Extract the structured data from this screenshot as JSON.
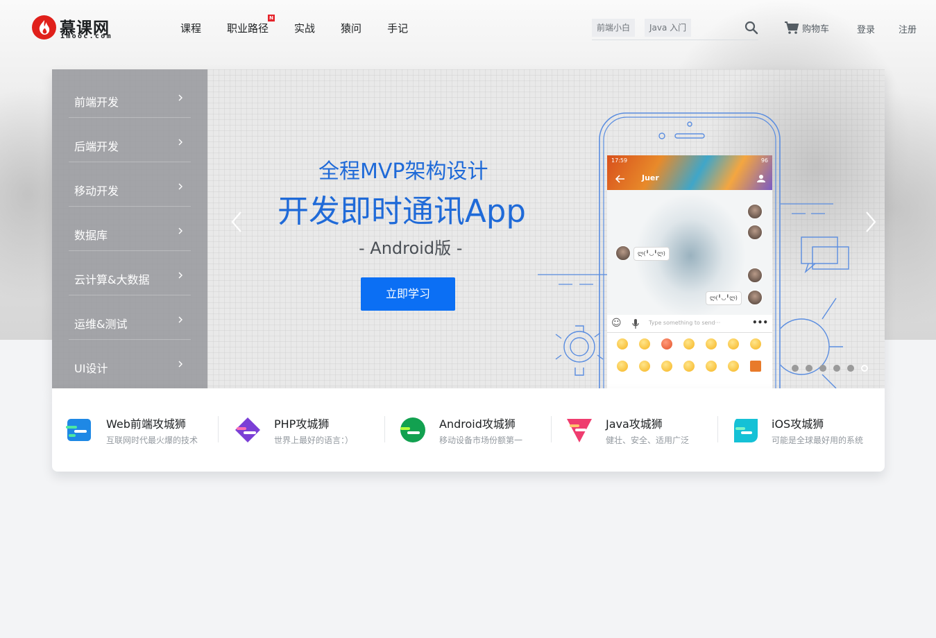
{
  "header": {
    "logo": {
      "title": "慕课网",
      "subtitle": "imooc.com"
    },
    "nav": [
      {
        "label": "课程",
        "new": false
      },
      {
        "label": "职业路径",
        "new": true,
        "badge": "N"
      },
      {
        "label": "实战",
        "new": false
      },
      {
        "label": "猿问",
        "new": false
      },
      {
        "label": "手记",
        "new": false
      }
    ],
    "search": {
      "tags": [
        "前端小白",
        "Java 入门"
      ],
      "value": ""
    },
    "cart_label": "购物车",
    "login_label": "登录",
    "register_label": "注册"
  },
  "menu": [
    "前端开发",
    "后端开发",
    "移动开发",
    "数据库",
    "云计算&大数据",
    "运维&测试",
    "UI设计"
  ],
  "slide": {
    "subtitle": "全程MVP架构设计",
    "title": "开发即时通讯App",
    "version": "- Android版 -",
    "cta": "立即学习",
    "phone": {
      "time": "17:59",
      "battery": "96",
      "chat_name": "Juer",
      "bubbles": [
        "ლ(╹◡╹ლ)",
        "ლ(╹◡╹ლ)"
      ],
      "input_placeholder": "Type something to send···"
    },
    "dots_total": 6,
    "active_dot": 6
  },
  "paths": [
    {
      "title": "Web前端攻城狮",
      "desc": "互联网时代最火爆的技术",
      "color": "#1e88e5"
    },
    {
      "title": "PHP攻城狮",
      "desc": "世界上最好的语言：）",
      "color": "#7b3fd6"
    },
    {
      "title": "Android攻城狮",
      "desc": "移动设备市场份额第一",
      "color": "#12a150"
    },
    {
      "title": "Java攻城狮",
      "desc": "健壮、安全、适用广泛",
      "color": "#ef3d6f"
    },
    {
      "title": "iOS攻城狮",
      "desc": "可能是全球最好用的系统",
      "color": "#15c1d6"
    }
  ],
  "colors": {
    "brand_red": "#e0201b",
    "cta_blue": "#0b6ff4",
    "headline_blue": "#1f6ad8"
  }
}
